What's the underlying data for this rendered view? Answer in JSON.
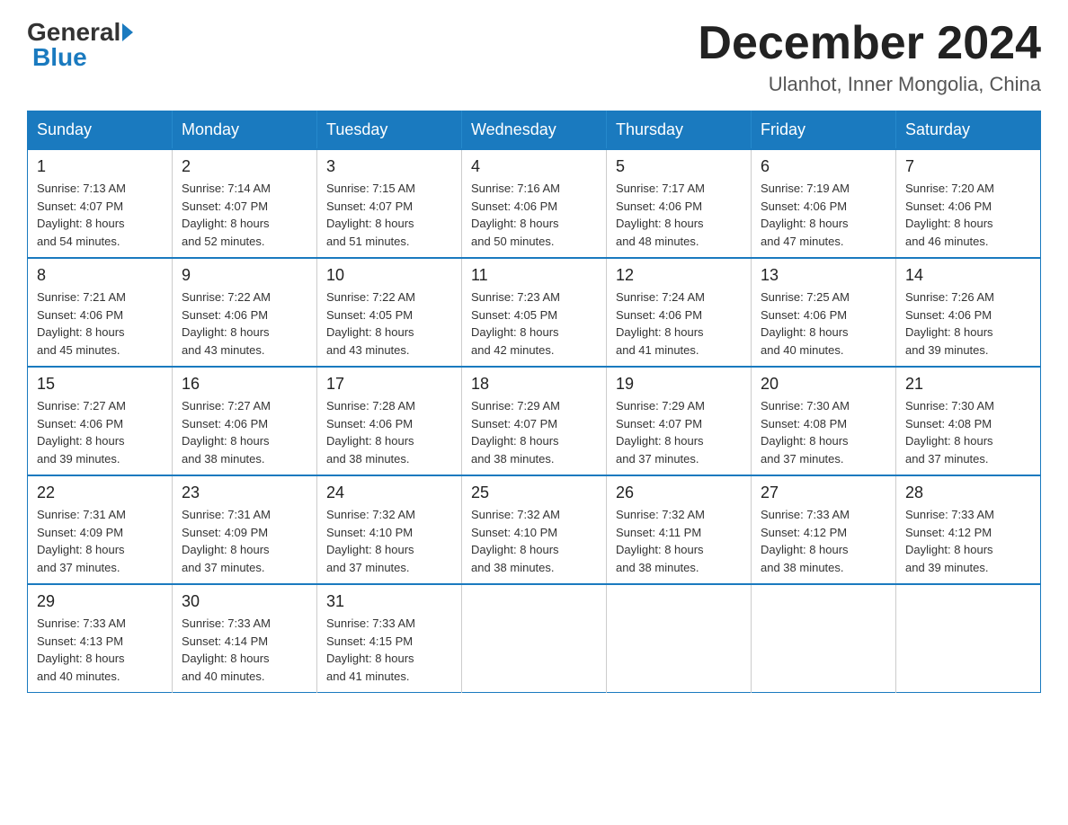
{
  "header": {
    "logo_general": "General",
    "logo_blue": "Blue",
    "month_title": "December 2024",
    "subtitle": "Ulanhot, Inner Mongolia, China"
  },
  "weekdays": [
    "Sunday",
    "Monday",
    "Tuesday",
    "Wednesday",
    "Thursday",
    "Friday",
    "Saturday"
  ],
  "weeks": [
    [
      {
        "day": "1",
        "sunrise": "7:13 AM",
        "sunset": "4:07 PM",
        "daylight": "8 hours and 54 minutes."
      },
      {
        "day": "2",
        "sunrise": "7:14 AM",
        "sunset": "4:07 PM",
        "daylight": "8 hours and 52 minutes."
      },
      {
        "day": "3",
        "sunrise": "7:15 AM",
        "sunset": "4:07 PM",
        "daylight": "8 hours and 51 minutes."
      },
      {
        "day": "4",
        "sunrise": "7:16 AM",
        "sunset": "4:06 PM",
        "daylight": "8 hours and 50 minutes."
      },
      {
        "day": "5",
        "sunrise": "7:17 AM",
        "sunset": "4:06 PM",
        "daylight": "8 hours and 48 minutes."
      },
      {
        "day": "6",
        "sunrise": "7:19 AM",
        "sunset": "4:06 PM",
        "daylight": "8 hours and 47 minutes."
      },
      {
        "day": "7",
        "sunrise": "7:20 AM",
        "sunset": "4:06 PM",
        "daylight": "8 hours and 46 minutes."
      }
    ],
    [
      {
        "day": "8",
        "sunrise": "7:21 AM",
        "sunset": "4:06 PM",
        "daylight": "8 hours and 45 minutes."
      },
      {
        "day": "9",
        "sunrise": "7:22 AM",
        "sunset": "4:06 PM",
        "daylight": "8 hours and 43 minutes."
      },
      {
        "day": "10",
        "sunrise": "7:22 AM",
        "sunset": "4:05 PM",
        "daylight": "8 hours and 43 minutes."
      },
      {
        "day": "11",
        "sunrise": "7:23 AM",
        "sunset": "4:05 PM",
        "daylight": "8 hours and 42 minutes."
      },
      {
        "day": "12",
        "sunrise": "7:24 AM",
        "sunset": "4:06 PM",
        "daylight": "8 hours and 41 minutes."
      },
      {
        "day": "13",
        "sunrise": "7:25 AM",
        "sunset": "4:06 PM",
        "daylight": "8 hours and 40 minutes."
      },
      {
        "day": "14",
        "sunrise": "7:26 AM",
        "sunset": "4:06 PM",
        "daylight": "8 hours and 39 minutes."
      }
    ],
    [
      {
        "day": "15",
        "sunrise": "7:27 AM",
        "sunset": "4:06 PM",
        "daylight": "8 hours and 39 minutes."
      },
      {
        "day": "16",
        "sunrise": "7:27 AM",
        "sunset": "4:06 PM",
        "daylight": "8 hours and 38 minutes."
      },
      {
        "day": "17",
        "sunrise": "7:28 AM",
        "sunset": "4:06 PM",
        "daylight": "8 hours and 38 minutes."
      },
      {
        "day": "18",
        "sunrise": "7:29 AM",
        "sunset": "4:07 PM",
        "daylight": "8 hours and 38 minutes."
      },
      {
        "day": "19",
        "sunrise": "7:29 AM",
        "sunset": "4:07 PM",
        "daylight": "8 hours and 37 minutes."
      },
      {
        "day": "20",
        "sunrise": "7:30 AM",
        "sunset": "4:08 PM",
        "daylight": "8 hours and 37 minutes."
      },
      {
        "day": "21",
        "sunrise": "7:30 AM",
        "sunset": "4:08 PM",
        "daylight": "8 hours and 37 minutes."
      }
    ],
    [
      {
        "day": "22",
        "sunrise": "7:31 AM",
        "sunset": "4:09 PM",
        "daylight": "8 hours and 37 minutes."
      },
      {
        "day": "23",
        "sunrise": "7:31 AM",
        "sunset": "4:09 PM",
        "daylight": "8 hours and 37 minutes."
      },
      {
        "day": "24",
        "sunrise": "7:32 AM",
        "sunset": "4:10 PM",
        "daylight": "8 hours and 37 minutes."
      },
      {
        "day": "25",
        "sunrise": "7:32 AM",
        "sunset": "4:10 PM",
        "daylight": "8 hours and 38 minutes."
      },
      {
        "day": "26",
        "sunrise": "7:32 AM",
        "sunset": "4:11 PM",
        "daylight": "8 hours and 38 minutes."
      },
      {
        "day": "27",
        "sunrise": "7:33 AM",
        "sunset": "4:12 PM",
        "daylight": "8 hours and 38 minutes."
      },
      {
        "day": "28",
        "sunrise": "7:33 AM",
        "sunset": "4:12 PM",
        "daylight": "8 hours and 39 minutes."
      }
    ],
    [
      {
        "day": "29",
        "sunrise": "7:33 AM",
        "sunset": "4:13 PM",
        "daylight": "8 hours and 40 minutes."
      },
      {
        "day": "30",
        "sunrise": "7:33 AM",
        "sunset": "4:14 PM",
        "daylight": "8 hours and 40 minutes."
      },
      {
        "day": "31",
        "sunrise": "7:33 AM",
        "sunset": "4:15 PM",
        "daylight": "8 hours and 41 minutes."
      },
      null,
      null,
      null,
      null
    ]
  ],
  "labels": {
    "sunrise": "Sunrise: ",
    "sunset": "Sunset: ",
    "daylight": "Daylight: "
  }
}
